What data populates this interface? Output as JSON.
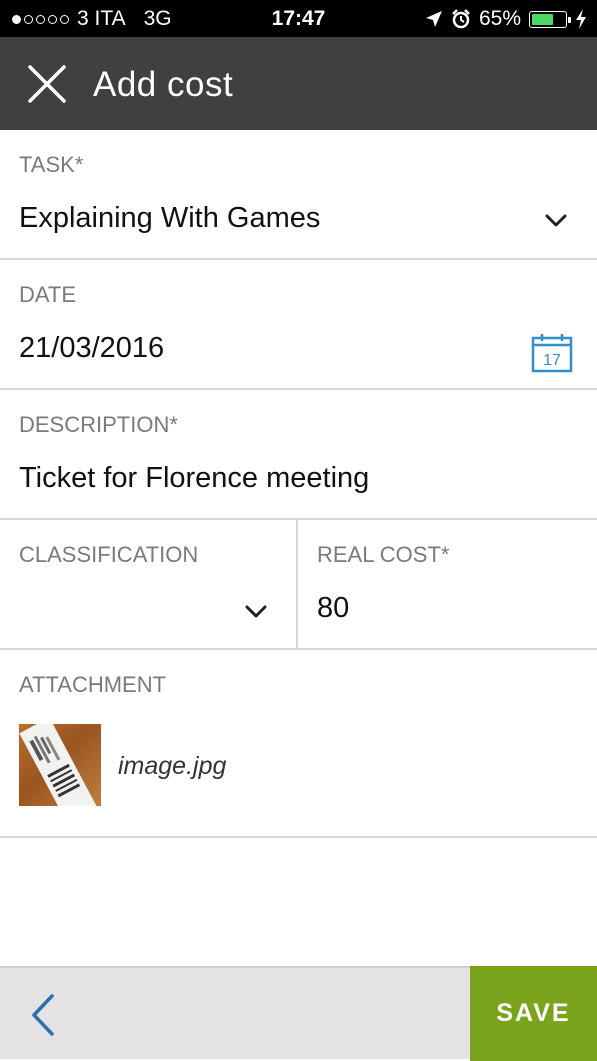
{
  "status_bar": {
    "carrier": "3 ITA",
    "network": "3G",
    "time": "17:47",
    "battery": "65%",
    "battery_level": 0.65,
    "signal_bars": 1
  },
  "header": {
    "title": "Add cost",
    "close_icon": "close-icon"
  },
  "form": {
    "task": {
      "label": "TASK*",
      "value": "Explaining With Games"
    },
    "date": {
      "label": "DATE",
      "value": "21/03/2016",
      "calendar_day": "17"
    },
    "description": {
      "label": "DESCRIPTION*",
      "value": "Ticket for Florence meeting"
    },
    "classification": {
      "label": "CLASSIFICATION",
      "value": ""
    },
    "real_cost": {
      "label": "REAL COST*",
      "value": "80"
    },
    "attachment": {
      "label": "ATTACHMENT",
      "file_name": "image.jpg"
    }
  },
  "footer": {
    "save_label": "SAVE"
  },
  "colors": {
    "header_bg": "#404040",
    "save_bg": "#7aa41c",
    "accent_blue": "#2f8fc7",
    "battery_green": "#4cd964"
  }
}
